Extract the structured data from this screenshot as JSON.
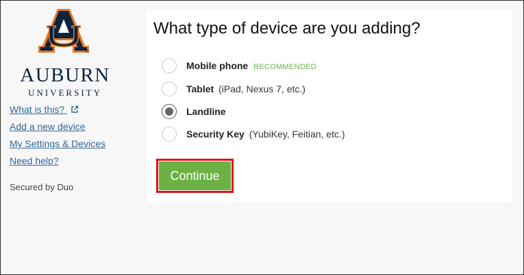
{
  "brand": {
    "wordmark": "AUBURN",
    "subtitle": "UNIVERSITY",
    "navy": "#0c2340",
    "orange": "#e87722"
  },
  "sidebar": {
    "links": [
      {
        "label": "What is this?",
        "icon": "external-link-icon"
      },
      {
        "label": "Add a new device"
      },
      {
        "label": "My Settings & Devices"
      },
      {
        "label": "Need help?"
      }
    ],
    "secured": "Secured by Duo"
  },
  "main": {
    "heading": "What type of device are you adding?",
    "options": [
      {
        "label": "Mobile phone",
        "tag": "RECOMMENDED",
        "desc": "",
        "selected": false
      },
      {
        "label": "Tablet",
        "tag": "",
        "desc": "(iPad, Nexus 7, etc.)",
        "selected": false
      },
      {
        "label": "Landline",
        "tag": "",
        "desc": "",
        "selected": true
      },
      {
        "label": "Security Key",
        "tag": "",
        "desc": "(YubiKey, Feitian, etc.)",
        "selected": false
      }
    ],
    "continue_label": "Continue",
    "continue_color": "#6bb144",
    "highlight_color": "#e0101a"
  }
}
